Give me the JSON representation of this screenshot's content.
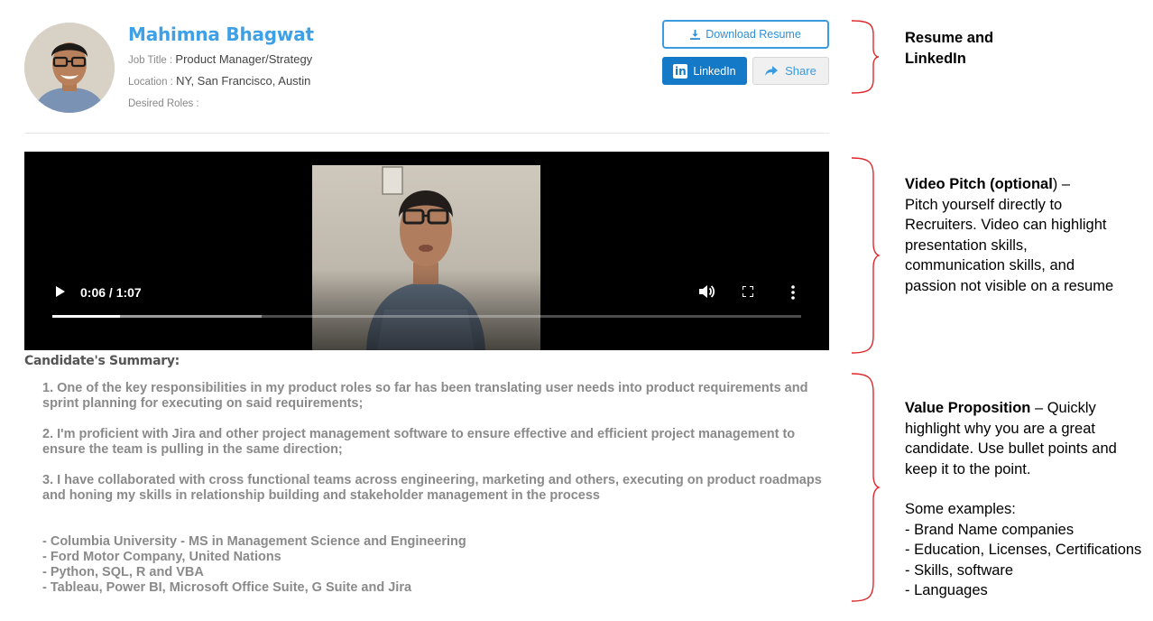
{
  "profile": {
    "name": "Mahimna Bhagwat",
    "job_title_label": "Job Title : ",
    "job_title": "Product Manager/Strategy",
    "location_label": "Location : ",
    "location": "NY, San Francisco, Austin",
    "desired_roles_label": "Desired Roles : ",
    "desired_roles": ""
  },
  "actions": {
    "download_label": "Download Resume",
    "linkedin_label": "LinkedIn",
    "linkedin_mark": "in",
    "share_label": "Share"
  },
  "video": {
    "time": "0:06 / 1:07",
    "progress_fraction": 0.09,
    "buffered_fraction": 0.28
  },
  "summary": {
    "title": "Candidate's Summary:",
    "points": [
      "1. One of the key responsibilities in my product roles so far has been translating user needs into product requirements and sprint planning for executing on said requirements;",
      "2. I'm proficient with Jira and other project management software to ensure effective and efficient project management to ensure the team is pulling in the same direction;",
      "3. I have collaborated with cross functional teams across engineering, marketing and others, executing on product roadmaps and honing my skills in relationship building and stakeholder management in the process"
    ],
    "bullets": [
      "- Columbia University - MS in Management Science and Engineering",
      "- Ford Motor Company, United Nations",
      "- Python, SQL, R and VBA",
      "- Tableau, Power BI, Microsoft Office Suite, G Suite and Jira"
    ]
  },
  "annotations": {
    "resume": {
      "line1": "Resume and",
      "line2": "LinkedIn"
    },
    "video": {
      "bold": "Video Pitch (optional",
      "rest_close": ")",
      "dash": " –",
      "text": "Pitch yourself directly to Recruiters. Video can highlight presentation skills, communication skills, and passion not visible on a resume"
    },
    "value": {
      "bold": "Value Proposition",
      "text": " – Quickly highlight why you are a great candidate. Use bullet points and keep it to the point.",
      "examples_title": "Some examples:",
      "examples": [
        "- Brand Name companies",
        "- Education, Licenses, Certifications",
        "- Skills, software",
        "- Languages"
      ]
    }
  },
  "colors": {
    "accent": "#3ea0e6",
    "linkedin": "#1479c7",
    "brace": "#e0262b"
  },
  "icons": {
    "download": "download-icon",
    "linkedin": "linkedin-icon",
    "share": "share-arrow-icon",
    "play": "play-icon",
    "volume": "volume-icon",
    "fullscreen": "fullscreen-icon",
    "more": "more-vertical-icon"
  }
}
